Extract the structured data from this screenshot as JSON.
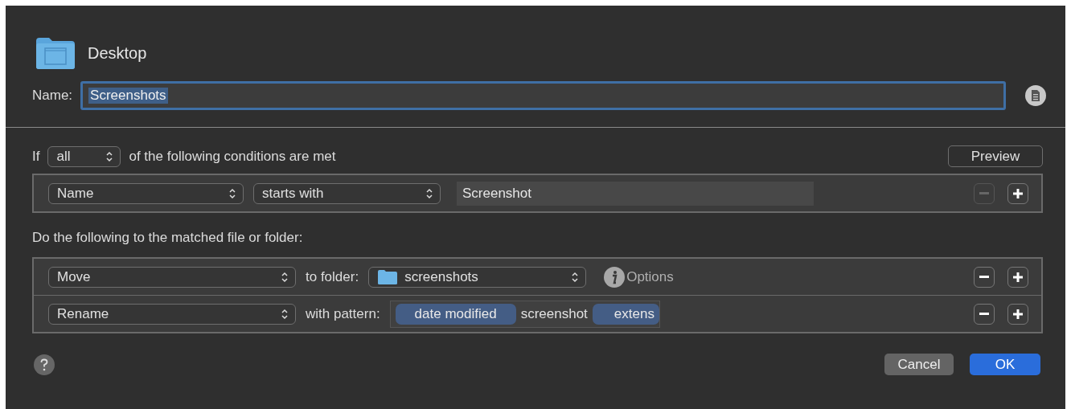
{
  "header": {
    "folder": "Desktop"
  },
  "name_field": {
    "label": "Name:",
    "value": "Screenshots",
    "text_selected": true
  },
  "conditions": {
    "prefix": "If",
    "match_popup": "all",
    "suffix": "of the following conditions are met",
    "preview_button": "Preview",
    "rows": [
      {
        "attribute": "Name",
        "operator": "starts with",
        "value": "Screenshot",
        "remove_disabled": true
      }
    ]
  },
  "actions": {
    "label": "Do the following to the matched file or folder:",
    "rows": [
      {
        "kind": "move",
        "action": "Move",
        "label": "to folder:",
        "folder": "screenshots",
        "options": "Options",
        "remove_disabled": false
      },
      {
        "kind": "rename",
        "action": "Rename",
        "label": "with pattern:",
        "remove_disabled": false,
        "pattern": [
          {
            "kind": "token",
            "text": "date modified"
          },
          {
            "kind": "text",
            "text": "screenshot"
          },
          {
            "kind": "token",
            "text": "extens"
          }
        ]
      }
    ]
  },
  "buttons": {
    "cancel": "Cancel",
    "ok": "OK"
  }
}
